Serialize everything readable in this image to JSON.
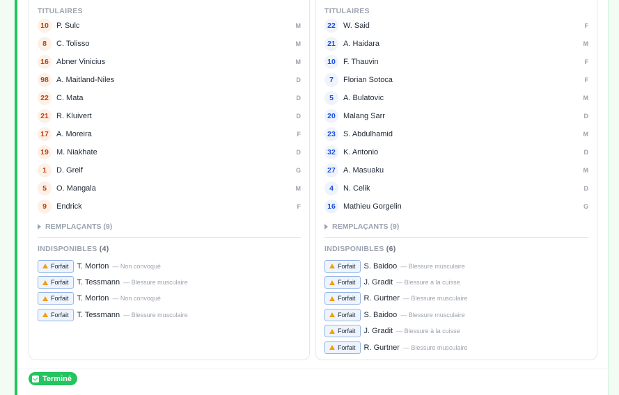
{
  "home": {
    "starters_title": "TITULAIRES",
    "starters": [
      {
        "num": "10",
        "name": "P. Sulc",
        "pos": "M"
      },
      {
        "num": "8",
        "name": "C. Tolisso",
        "pos": "M"
      },
      {
        "num": "16",
        "name": "Abner Vinicius",
        "pos": "M"
      },
      {
        "num": "98",
        "name": "A. Maitland-Niles",
        "pos": "D"
      },
      {
        "num": "22",
        "name": "C. Mata",
        "pos": "D"
      },
      {
        "num": "21",
        "name": "R. Kluivert",
        "pos": "D"
      },
      {
        "num": "17",
        "name": "A. Moreira",
        "pos": "F"
      },
      {
        "num": "19",
        "name": "M. Niakhate",
        "pos": "D"
      },
      {
        "num": "1",
        "name": "D. Greif",
        "pos": "G"
      },
      {
        "num": "5",
        "name": "O. Mangala",
        "pos": "M"
      },
      {
        "num": "9",
        "name": "Endrick",
        "pos": "F"
      }
    ],
    "subs_label": "REMPLAÇANTS (9)",
    "unavailable_title": "INDISPONIBLES",
    "unavailable_count": "(4)",
    "unavailable": [
      {
        "badge": "Forfait",
        "name": "T. Morton",
        "reason": "— Non convoqué"
      },
      {
        "badge": "Forfait",
        "name": "T. Tessmann",
        "reason": "— Blessure musculaire"
      },
      {
        "badge": "Forfait",
        "name": "T. Morton",
        "reason": "— Non convoqué"
      },
      {
        "badge": "Forfait",
        "name": "T. Tessmann",
        "reason": "— Blessure musculaire"
      }
    ]
  },
  "away": {
    "starters_title": "TITULAIRES",
    "starters": [
      {
        "num": "22",
        "name": "W. Said",
        "pos": "F"
      },
      {
        "num": "21",
        "name": "A. Haidara",
        "pos": "M"
      },
      {
        "num": "10",
        "name": "F. Thauvin",
        "pos": "F"
      },
      {
        "num": "7",
        "name": "Florian Sotoca",
        "pos": "F"
      },
      {
        "num": "5",
        "name": "A. Bulatovic",
        "pos": "M"
      },
      {
        "num": "20",
        "name": "Malang Sarr",
        "pos": "D"
      },
      {
        "num": "23",
        "name": "S. Abdulhamid",
        "pos": "M"
      },
      {
        "num": "32",
        "name": "K. Antonio",
        "pos": "D"
      },
      {
        "num": "27",
        "name": "A. Masuaku",
        "pos": "M"
      },
      {
        "num": "4",
        "name": "N. Celik",
        "pos": "D"
      },
      {
        "num": "16",
        "name": "Mathieu Gorgelin",
        "pos": "G"
      }
    ],
    "subs_label": "REMPLAÇANTS (9)",
    "unavailable_title": "INDISPONIBLES",
    "unavailable_count": "(6)",
    "unavailable": [
      {
        "badge": "Forfait",
        "name": "S. Baidoo",
        "reason": "— Blessure musculaire"
      },
      {
        "badge": "Forfait",
        "name": "J. Gradit",
        "reason": "— Blessure à la cuisse"
      },
      {
        "badge": "Forfait",
        "name": "R. Gurtner",
        "reason": "— Blessure musculaire"
      },
      {
        "badge": "Forfait",
        "name": "S. Baidoo",
        "reason": "— Blessure musculaire"
      },
      {
        "badge": "Forfait",
        "name": "J. Gradit",
        "reason": "— Blessure à la cuisse"
      },
      {
        "badge": "Forfait",
        "name": "R. Gurtner",
        "reason": "— Blessure musculaire"
      }
    ]
  },
  "status": {
    "label": "Terminé"
  },
  "colors": {
    "accent": "#22c55e",
    "home_number": "#c2410c",
    "away_number": "#1d4ed8",
    "warning": "#f59e0b"
  },
  "icons": {
    "warning": "warning-triangle-icon",
    "expand": "caret-right-icon",
    "status": "checkbox-checked-icon"
  }
}
